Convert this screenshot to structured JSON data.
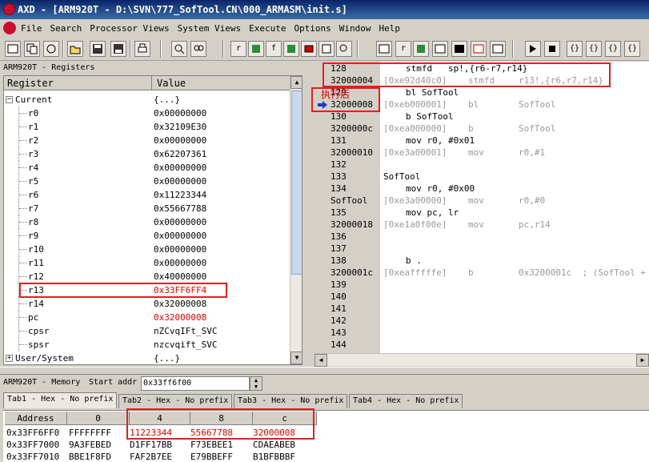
{
  "window": {
    "title": "AXD - [ARM920T - D:\\SVN\\777_SofTool.CN\\000_ARMASM\\init.s]"
  },
  "menu": [
    "File",
    "Search",
    "Processor Views",
    "System Views",
    "Execute",
    "Options",
    "Window",
    "Help"
  ],
  "registers": {
    "pane_title": "ARM920T - Registers",
    "col_register": "Register",
    "col_value": "Value",
    "group_current": {
      "name": "Current",
      "value": "{...}"
    },
    "rows": [
      {
        "name": "r0",
        "value": "0x00000000",
        "changed": false
      },
      {
        "name": "r1",
        "value": "0x32109E30",
        "changed": false
      },
      {
        "name": "r2",
        "value": "0x00000000",
        "changed": false
      },
      {
        "name": "r3",
        "value": "0x62207361",
        "changed": false
      },
      {
        "name": "r4",
        "value": "0x00000000",
        "changed": false
      },
      {
        "name": "r5",
        "value": "0x00000000",
        "changed": false
      },
      {
        "name": "r6",
        "value": "0x11223344",
        "changed": false
      },
      {
        "name": "r7",
        "value": "0x55667788",
        "changed": false
      },
      {
        "name": "r8",
        "value": "0x00000000",
        "changed": false
      },
      {
        "name": "r9",
        "value": "0x00000000",
        "changed": false
      },
      {
        "name": "r10",
        "value": "0x00000000",
        "changed": false
      },
      {
        "name": "r11",
        "value": "0x00000000",
        "changed": false
      },
      {
        "name": "r12",
        "value": "0x40000000",
        "changed": false
      },
      {
        "name": "r13",
        "value": "0x33FF6FF4",
        "changed": true
      },
      {
        "name": "r14",
        "value": "0x32000008",
        "changed": false
      },
      {
        "name": "pc",
        "value": "0x32000008",
        "changed": true
      },
      {
        "name": "cpsr",
        "value": "nZCvqIFt_SVC",
        "changed": false
      },
      {
        "name": "spsr",
        "value": "nzcvqift_SVC",
        "changed": false
      }
    ],
    "group_user": {
      "name": "User/System",
      "value": "{...}"
    }
  },
  "source": {
    "lines": [
      {
        "ln": "128",
        "code": "stmfd   sp!,{r6-r7,r14}",
        "indent": true
      },
      {
        "ln": "32000004",
        "dis": "[0xe92d40c0]",
        "mn": "stmfd",
        "op": "r13!,{r6,r7,r14}"
      },
      {
        "ln": "129",
        "code": "bl SofTool",
        "indent": true
      },
      {
        "ln": "32000008",
        "dis": "[0xeb000001]",
        "mn": "bl",
        "op": "SofTool",
        "pc": true
      },
      {
        "ln": "130",
        "code": "b SofTool",
        "indent": true
      },
      {
        "ln": "3200000c",
        "dis": "[0xea000000]",
        "mn": "b",
        "op": "SofTool"
      },
      {
        "ln": "131",
        "code": "mov r0, #0x01",
        "indent": true
      },
      {
        "ln": "32000010",
        "dis": "[0xe3a00001]",
        "mn": "mov",
        "op": "r0,#1"
      },
      {
        "ln": "132",
        "code": ""
      },
      {
        "ln": "133",
        "code": "SofTool",
        "indent": false
      },
      {
        "ln": "134",
        "code": "mov r0, #0x00",
        "indent": true
      },
      {
        "ln": "SofTool",
        "dis": "[0xe3a00000]",
        "mn": "mov",
        "op": "r0,#0"
      },
      {
        "ln": "135",
        "code": "mov pc, lr",
        "indent": true
      },
      {
        "ln": "32000018",
        "dis": "[0xe1a0f00e]",
        "mn": "mov",
        "op": "pc,r14"
      },
      {
        "ln": "136",
        "code": ""
      },
      {
        "ln": "137",
        "code": ""
      },
      {
        "ln": "138",
        "code": "b .",
        "indent": true
      },
      {
        "ln": "3200001c",
        "dis": "[0xeafffffe]",
        "mn": "b",
        "op": "0x3200001c  ; (SofTool +"
      },
      {
        "ln": "139",
        "code": ""
      },
      {
        "ln": "140",
        "code": ""
      },
      {
        "ln": "141",
        "code": ""
      },
      {
        "ln": "142",
        "code": ""
      },
      {
        "ln": "143",
        "code": ""
      },
      {
        "ln": "144",
        "code": ""
      }
    ]
  },
  "annotation": {
    "label": "执行后"
  },
  "memory": {
    "pane_title": "ARM920T - Memory",
    "start_label": "Start addr",
    "start_value": "0x33ff6f00",
    "tabs": [
      "Tab1 - Hex - No prefix",
      "Tab2 - Hex - No prefix",
      "Tab3 - Hex - No prefix",
      "Tab4 - Hex - No prefix"
    ],
    "headers": [
      "Address",
      "0",
      "4",
      "8",
      "c"
    ],
    "rows": [
      {
        "addr": "0x33FF6FF0",
        "c0": "FFFFFFFF",
        "c4": "11223344",
        "c8": "55667788",
        "cc": "32000008",
        "highlight": true
      },
      {
        "addr": "0x33FF7000",
        "c0": "9A3FEBED",
        "c4": "D1FF17BB",
        "c8": "F73EBEE1",
        "cc": "CDAEABEB",
        "highlight": false
      },
      {
        "addr": "0x33FF7010",
        "c0": "BBE1F8FD",
        "c4": "FAF2B7EE",
        "c8": "E79BBEFF",
        "cc": "B1BFBBBF",
        "highlight": false
      }
    ]
  }
}
